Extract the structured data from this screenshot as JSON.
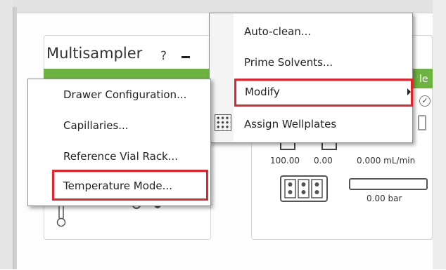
{
  "module": {
    "title": "Multisampler",
    "help": "?",
    "right_green_fragment": "le"
  },
  "context_menu": {
    "items": [
      {
        "label": "Drawer Configuration..."
      },
      {
        "label": "Capillaries..."
      },
      {
        "label": "Reference Vial Rack..."
      },
      {
        "label": "Temperature Mode..."
      }
    ],
    "highlighted": "Temperature Mode..."
  },
  "main_menu": {
    "items": [
      {
        "label": "Auto-clean..."
      },
      {
        "label": "Prime Solvents..."
      },
      {
        "label": "Modify"
      },
      {
        "label": "Assign Wellplates"
      }
    ],
    "highlighted": "Modify"
  },
  "pump_readouts": {
    "value_a": "100.00",
    "value_b": "0.00",
    "flow": "0.000 mL/min",
    "pressure": "0.00 bar"
  },
  "colors": {
    "status_green": "#6db33f",
    "highlight_red": "#e8202a"
  }
}
